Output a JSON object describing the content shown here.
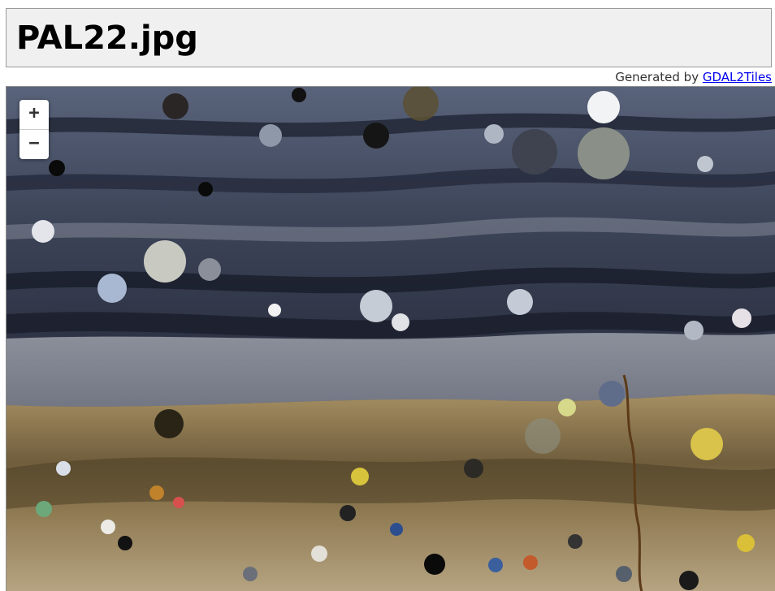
{
  "header": {
    "title": "PAL22.jpg"
  },
  "subheader": {
    "generated_by": "Generated by ",
    "link_text": "GDAL2Tiles"
  },
  "map": {
    "zoom_in_label": "+",
    "zoom_out_label": "−"
  },
  "colors": {
    "header_bg": "#f0f0f0",
    "link": "#0000ee",
    "rock_dark_band": "#2e3446",
    "rock_gray_band": "#8e929c",
    "rock_brown_band": "#9a8256",
    "rock_light_bottom": "#b9a785"
  }
}
